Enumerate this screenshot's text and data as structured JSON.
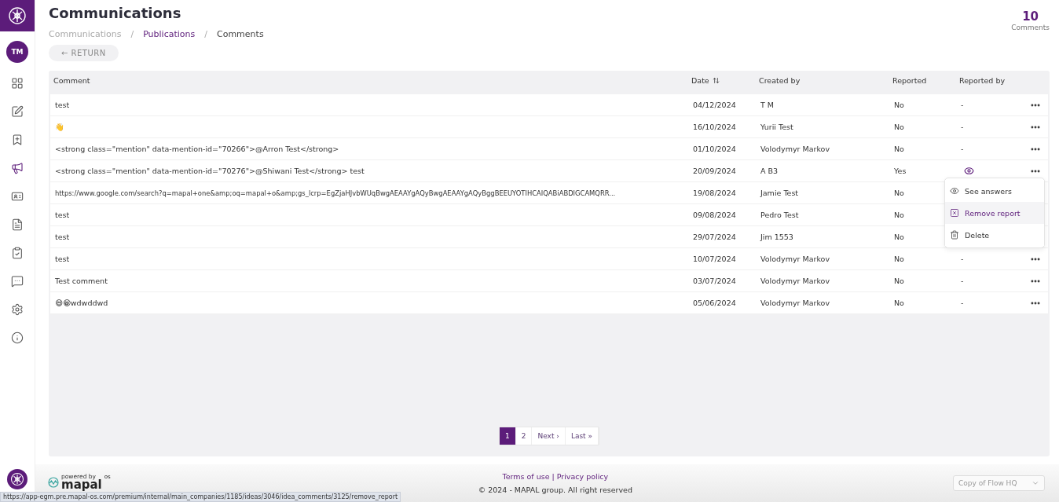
{
  "sidebar": {
    "avatar": "TM",
    "items": [
      {
        "kind": "grid",
        "selected": false
      },
      {
        "kind": "edit",
        "selected": false
      },
      {
        "kind": "bookmark",
        "selected": false
      },
      {
        "kind": "megaphone",
        "selected": true
      },
      {
        "kind": "card",
        "selected": false
      },
      {
        "kind": "document",
        "selected": false
      },
      {
        "kind": "clipboard",
        "selected": false
      },
      {
        "kind": "chat",
        "selected": false
      },
      {
        "kind": "settings",
        "selected": false
      },
      {
        "kind": "info",
        "selected": false
      }
    ]
  },
  "header": {
    "title": "Communications",
    "breadcrumbs": [
      {
        "label": "Communications",
        "selected": false
      },
      {
        "label": "Publications",
        "selected": false,
        "link": true
      },
      {
        "label": "Comments",
        "selected": true
      }
    ],
    "breadcrumb_separator": "/",
    "return_button": "← RETURN",
    "count": "10",
    "count_label": "Comments"
  },
  "table": {
    "columns": [
      {
        "label": "Comment"
      },
      {
        "label": "Date",
        "sortable": true
      },
      {
        "label": "Created by"
      },
      {
        "label": "Reported"
      },
      {
        "label": "Reported by"
      }
    ],
    "rows": [
      {
        "comment": "test",
        "date": "04/12/2024",
        "created_by": "T M",
        "reported": "No",
        "reported_by": "-",
        "more": true
      },
      {
        "comment": "👋",
        "date": "16/10/2024",
        "created_by": "Yurii Test",
        "reported": "No",
        "reported_by": "-",
        "more": true
      },
      {
        "comment": "<strong class=\"mention\" data-mention-id=\"70266\">@Arron Test</strong>",
        "date": "01/10/2024",
        "created_by": "Volodymyr Markov",
        "reported": "No",
        "reported_by": "-",
        "more": true
      },
      {
        "comment": "<strong class=\"mention\" data-mention-id=\"70276\">@Shiwani Test</strong> test",
        "date": "20/09/2024",
        "created_by": "A B3",
        "reported": "Yes",
        "view_reporters": true,
        "more": true
      },
      {
        "comment": "https://www.google.com/search?q=mapal+one&amp;oq=mapal+o&amp;gs_lcrp=EgZjaHJvbWUqBwgAEAAYgAQyBwgAEAAYgAQyBggBEEUYOTIHCAIQABiABDIGCAMQRR...",
        "date": "19/08/2024",
        "created_by": "Jamie Test",
        "reported": "No"
      },
      {
        "comment": "test",
        "date": "09/08/2024",
        "created_by": "Pedro Test",
        "reported": "No"
      },
      {
        "comment": "test",
        "date": "29/07/2024",
        "created_by": "Jim 1553",
        "reported": "No"
      },
      {
        "comment": "test",
        "date": "10/07/2024",
        "created_by": "Volodymyr Markov",
        "reported": "No",
        "reported_by": "-",
        "more": true
      },
      {
        "comment": "Test comment",
        "date": "03/07/2024",
        "created_by": "Volodymyr Markov",
        "reported": "No",
        "reported_by": "-",
        "more": true
      },
      {
        "comment": "😄😁wdwddwd",
        "date": "05/06/2024",
        "created_by": "Volodymyr Markov",
        "reported": "No",
        "reported_by": "-",
        "more": true
      }
    ]
  },
  "row_menu": {
    "items": [
      {
        "kind": "eye",
        "label": "See answers",
        "selected": false
      },
      {
        "kind": "remove",
        "label": "Remove report",
        "selected": true
      },
      {
        "kind": "trash",
        "label": "Delete",
        "selected": false
      }
    ]
  },
  "pagination": [
    {
      "label": "1",
      "selected": true
    },
    {
      "label": "2",
      "selected": false
    },
    {
      "label": "Next ›",
      "selected": false
    },
    {
      "label": "Last »",
      "selected": false
    }
  ],
  "footer": {
    "powered_by": "powered by",
    "brand": "mapal",
    "brand_suffix": "os",
    "links": [
      {
        "label": "Terms of use"
      },
      {
        "label": "Privacy policy"
      }
    ],
    "separator": "|",
    "copyright": "© 2024 - MAPAL group. All right reserved",
    "company_select": "Copy of Flow HQ"
  },
  "status_url": "https://app-egm.pre.mapal-os.com/premium/internal/main_companies/1185/ideas/3046/idea_comments/3125/remove_report"
}
